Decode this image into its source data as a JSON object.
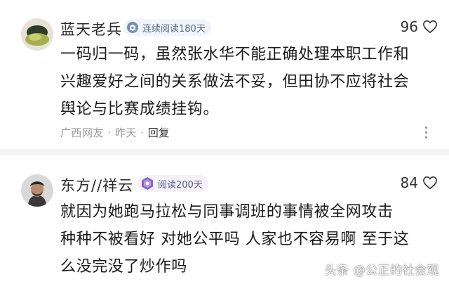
{
  "comments": [
    {
      "username": "蓝天老兵",
      "badge": "连续阅读180天",
      "likes": "96",
      "lines": [
        "一码归一码，虽然张水华不能正确处理本职工作和",
        "兴趣爱好之间的关系做法不妥，但田协不应将社会",
        "舆论与比赛成绩挂钩。"
      ],
      "location": "广西网友",
      "time": "昨天",
      "reply_label": "回复",
      "icons": {
        "like": "heart-outline-icon",
        "more": "vertical-ellipsis-icon",
        "badge": "reading-badge-icon"
      }
    },
    {
      "username": "东方//祥云",
      "badge": "阅读200天",
      "likes": "84",
      "lines": [
        "就因为她跑马拉松与同事调班的事情被全网攻击",
        "种种不被看好 对她公平吗 人家也不容易啊 至于这",
        "么没完没了炒作吗"
      ],
      "icons": {
        "like": "heart-outline-icon",
        "badge": "purple-reading-badge-icon"
      }
    }
  ],
  "watermark": "头条 @公正的社会观",
  "colors": {
    "badge_blue": "#526a87",
    "badge_purple": "#8a63c9",
    "meta_gray": "#9a9a9a"
  }
}
